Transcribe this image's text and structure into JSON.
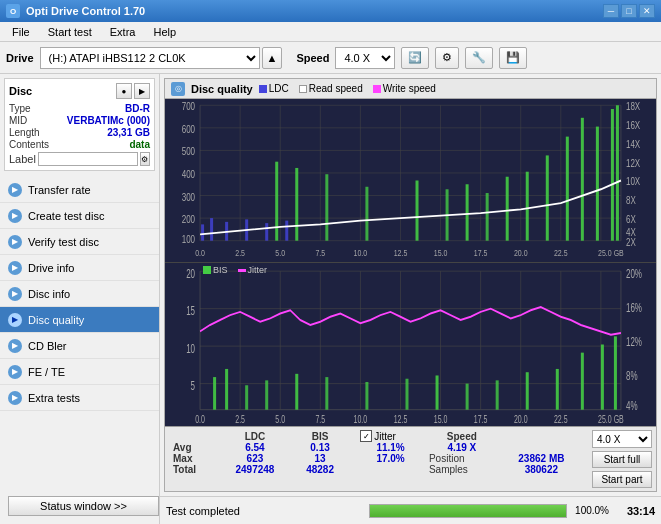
{
  "titlebar": {
    "title": "Opti Drive Control 1.70",
    "min": "─",
    "max": "□",
    "close": "✕"
  },
  "menu": {
    "items": [
      "File",
      "Start test",
      "Extra",
      "Help"
    ]
  },
  "toolbar": {
    "drive_label": "Drive",
    "drive_value": "(H:) ATAPI iHBS112  2 CL0K",
    "speed_label": "Speed",
    "speed_value": "4.0 X"
  },
  "disc": {
    "header": "Disc",
    "type_label": "Type",
    "type_value": "BD-R",
    "mid_label": "MID",
    "mid_value": "VERBATIMc (000)",
    "length_label": "Length",
    "length_value": "23,31 GB",
    "contents_label": "Contents",
    "contents_value": "data",
    "label_label": "Label",
    "label_value": ""
  },
  "nav": {
    "items": [
      {
        "id": "transfer-rate",
        "label": "Transfer rate",
        "icon": "▶"
      },
      {
        "id": "create-test-disc",
        "label": "Create test disc",
        "icon": "▶"
      },
      {
        "id": "verify-test-disc",
        "label": "Verify test disc",
        "icon": "▶"
      },
      {
        "id": "drive-info",
        "label": "Drive info",
        "icon": "▶"
      },
      {
        "id": "disc-info",
        "label": "Disc info",
        "icon": "▶"
      },
      {
        "id": "disc-quality",
        "label": "Disc quality",
        "icon": "▶",
        "active": true
      },
      {
        "id": "cd-bler",
        "label": "CD Bler",
        "icon": "▶"
      },
      {
        "id": "fe-te",
        "label": "FE / TE",
        "icon": "▶"
      },
      {
        "id": "extra-tests",
        "label": "Extra tests",
        "icon": "▶"
      }
    ]
  },
  "status_btn": "Status window >>",
  "disc_quality": {
    "title": "Disc quality",
    "legend": [
      {
        "label": "LDC",
        "color": "#4444ff"
      },
      {
        "label": "Read speed",
        "color": "#ffffff"
      },
      {
        "label": "Write speed",
        "color": "#ff44ff"
      }
    ],
    "chart1": {
      "ymax": 700,
      "y_labels_left": [
        "700",
        "600",
        "500",
        "400",
        "300",
        "200",
        "100"
      ],
      "y_labels_right": [
        "18X",
        "16X",
        "14X",
        "12X",
        "10X",
        "8X",
        "6X",
        "4X",
        "2X"
      ],
      "x_labels": [
        "0.0",
        "2.5",
        "5.0",
        "7.5",
        "10.0",
        "12.5",
        "15.0",
        "17.5",
        "20.0",
        "22.5",
        "25.0 GB"
      ]
    },
    "chart2": {
      "legend": [
        {
          "label": "BIS",
          "color": "#44ff44"
        },
        {
          "label": "Jitter",
          "color": "#ff44ff"
        }
      ],
      "ymax": 20,
      "y_labels_left": [
        "20",
        "15",
        "10",
        "5"
      ],
      "y_labels_right": [
        "20%",
        "16%",
        "12%",
        "8%",
        "4%"
      ],
      "x_labels": [
        "0.0",
        "2.5",
        "5.0",
        "7.5",
        "10.0",
        "12.5",
        "15.0",
        "17.5",
        "20.0",
        "22.5",
        "25.0 GB"
      ]
    }
  },
  "stats": {
    "headers": [
      "",
      "LDC",
      "BIS",
      "",
      "Jitter",
      "Speed",
      ""
    ],
    "avg_label": "Avg",
    "avg_ldc": "6.54",
    "avg_bis": "0.13",
    "avg_jitter": "11.1%",
    "avg_speed": "4.19 X",
    "max_label": "Max",
    "max_ldc": "623",
    "max_bis": "13",
    "max_jitter": "17.0%",
    "max_position": "23862 MB",
    "total_label": "Total",
    "total_ldc": "2497248",
    "total_bis": "48282",
    "total_samples": "380622",
    "speed_select": "4.0 X",
    "position_label": "Position",
    "samples_label": "Samples",
    "jitter_checked": true,
    "jitter_label": "Jitter",
    "start_full_label": "Start full",
    "start_part_label": "Start part"
  },
  "bottom": {
    "status_text": "Test completed",
    "progress": 100,
    "time": "33:14"
  },
  "colors": {
    "accent": "#3b7bbf",
    "sidebar_bg": "#f0f0f0",
    "chart_bg": "#2a2a3e",
    "ldc_color": "#4444dd",
    "bis_color": "#44cc44",
    "jitter_color": "#ee44ee",
    "read_speed_color": "#ffffff",
    "write_speed_color": "#ff44ff"
  }
}
